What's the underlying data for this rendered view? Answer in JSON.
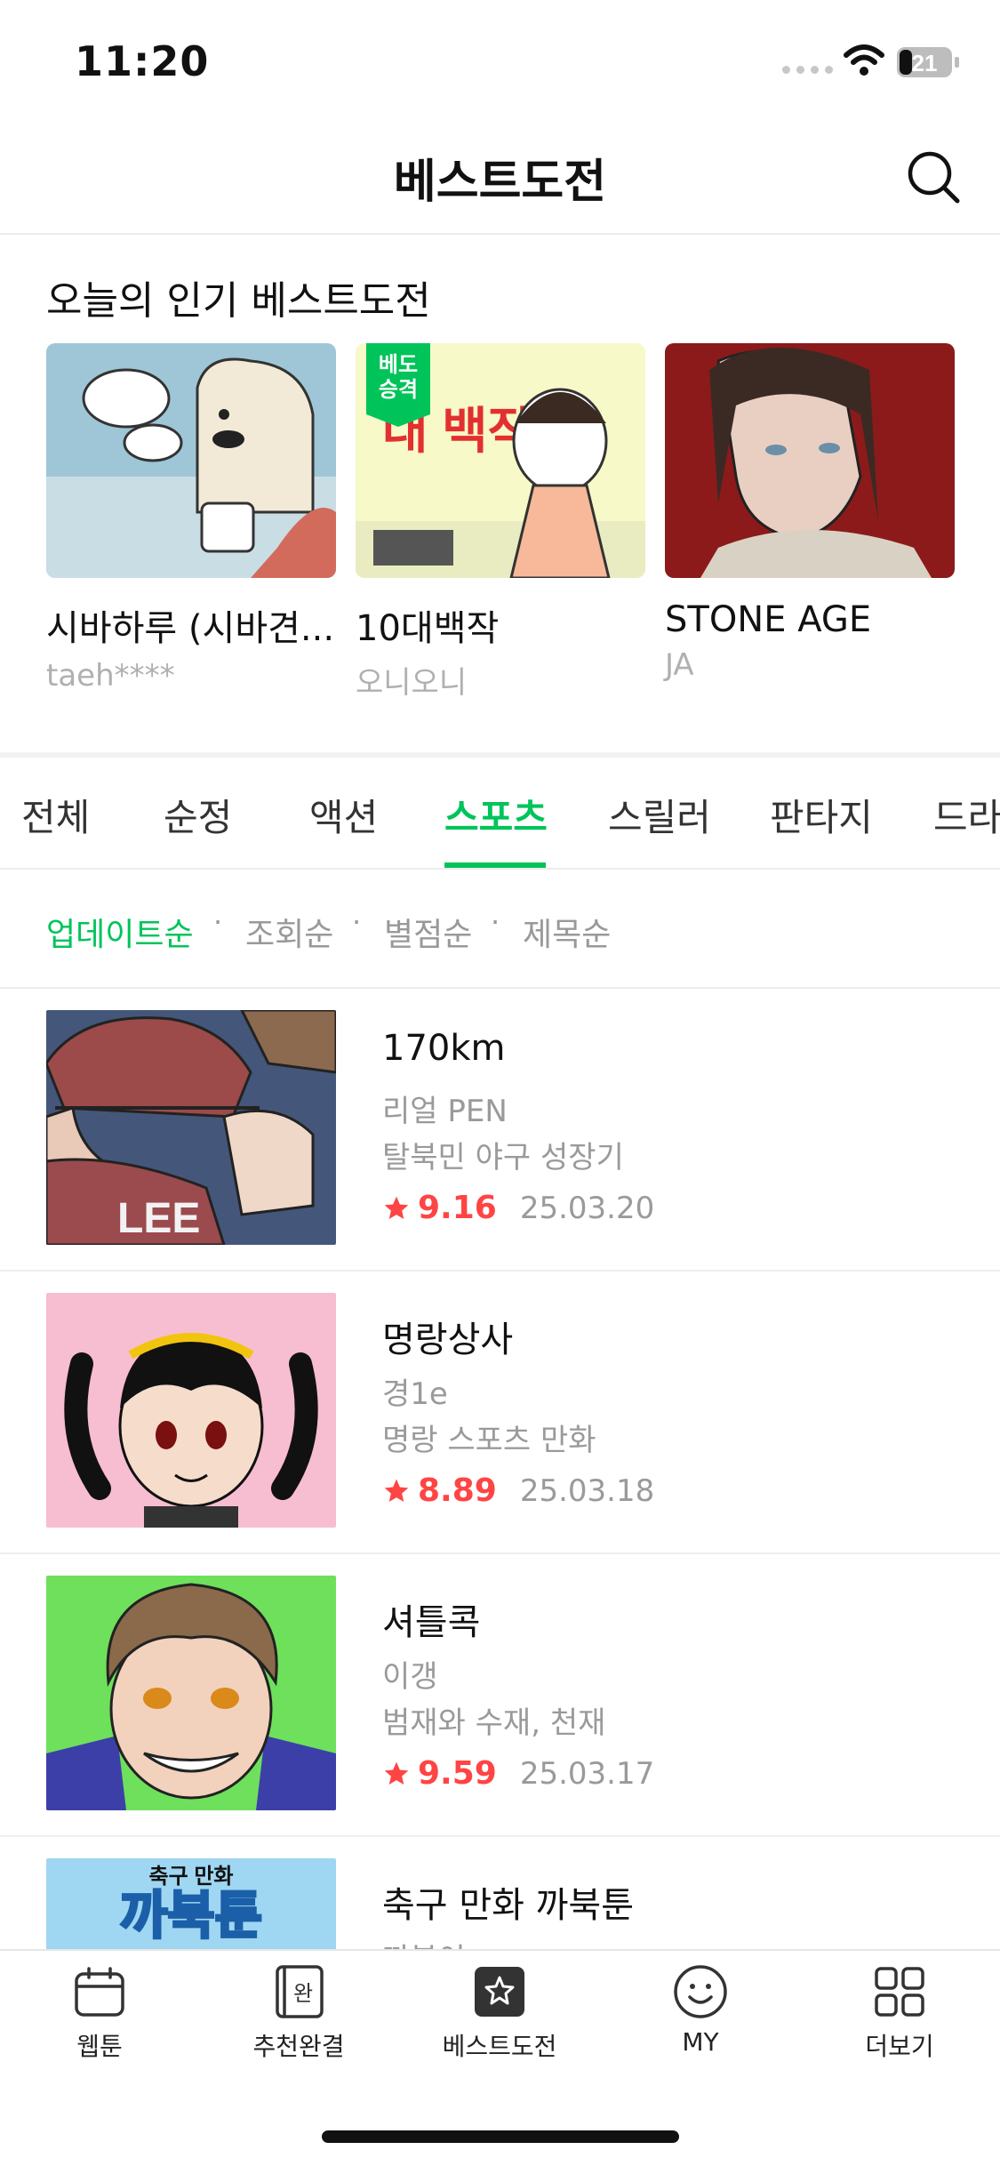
{
  "status_bar": {
    "time": "11:20",
    "battery": "21"
  },
  "header": {
    "title": "베스트도전",
    "search_icon": "search-icon"
  },
  "popular": {
    "section_title": "오늘의 인기 베스트도전",
    "cards": [
      {
        "title": "시바하루 (시바견...",
        "author": "taeh****"
      },
      {
        "title": "10대백작",
        "author": "오니오니",
        "badge": "베도\n승격",
        "thumb_text": "대 백작"
      },
      {
        "title": "STONE AGE",
        "author": "JA"
      }
    ]
  },
  "genre_tabs": [
    "전체",
    "순정",
    "액션",
    "스포츠",
    "스릴러",
    "판타지",
    "드라"
  ],
  "active_genre": "스포츠",
  "sort_options": [
    "업데이트순",
    "조회순",
    "별점순",
    "제목순"
  ],
  "active_sort": "업데이트순",
  "comics": [
    {
      "title": "170km",
      "author": "리얼 PEN",
      "description": "탈북민 야구 성장기",
      "rating": "9.16",
      "date": "25.03.20",
      "thumb_text": "LEE"
    },
    {
      "title": "명랑상사",
      "author": "경1e",
      "description": "명랑 스포츠 만화",
      "rating": "8.89",
      "date": "25.03.18"
    },
    {
      "title": "셔틀콕",
      "author": "이갱",
      "description": "범재와 수재, 천재",
      "rating": "9.59",
      "date": "25.03.17"
    },
    {
      "title": "축구 만화 까북툰",
      "author": "까북이",
      "description": "",
      "rating": "",
      "date": "",
      "thumb_text_top": "축구 만화",
      "thumb_text": "까북툰"
    }
  ],
  "bottom_nav": [
    {
      "label": "웹툰",
      "icon": "calendar-icon"
    },
    {
      "label": "추천완결",
      "icon": "book-icon",
      "icon_text": "완"
    },
    {
      "label": "베스트도전",
      "icon": "star-box-icon"
    },
    {
      "label": "MY",
      "icon": "smiley-icon"
    },
    {
      "label": "더보기",
      "icon": "grid-icon"
    }
  ],
  "colors": {
    "accent": "#00c45a",
    "rating": "#ff4444",
    "muted": "#9a9a9a"
  }
}
